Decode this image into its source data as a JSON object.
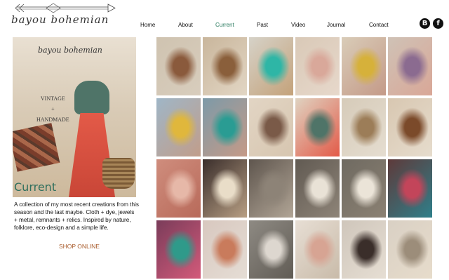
{
  "header": {
    "logo_text": "bayou bohemian",
    "logo_icon": "arrow-logo-icon"
  },
  "nav": {
    "items": [
      {
        "label": "Home",
        "active": false
      },
      {
        "label": "About",
        "active": false
      },
      {
        "label": "Current",
        "active": true
      },
      {
        "label": "Past",
        "active": false
      },
      {
        "label": "Video",
        "active": false
      },
      {
        "label": "Journal",
        "active": false
      },
      {
        "label": "Contact",
        "active": false
      }
    ],
    "active_color": "#2e7d62"
  },
  "social": {
    "blogger_glyph": "B",
    "facebook_glyph": "f",
    "icons": [
      "blogger-icon",
      "facebook-icon"
    ]
  },
  "hero": {
    "logo_text": "bayou bohemian",
    "vintage": "VINTAGE",
    "plus": "+",
    "handmade": "HANDMADE",
    "section_label": "Current"
  },
  "description": "A collection of my most recent creations from this season and the last maybe.  Cloth + dye, jewels + metal, remnants + relics. Inspired by nature, folklore, eco-design and a simple life.",
  "shop_link": "SHOP ONLINE",
  "gallery": {
    "tiles": [
      {
        "colors": [
          "#cfc3b0",
          "#8a5a3c",
          "#d8cdbd"
        ]
      },
      {
        "colors": [
          "#c9b69c",
          "#8a5f3b",
          "#e2d6c4"
        ]
      },
      {
        "colors": [
          "#d6d2c8",
          "#2eb6a6",
          "#c4a27a"
        ]
      },
      {
        "colors": [
          "#d9c9b7",
          "#d9a89a",
          "#e7d8cb"
        ]
      },
      {
        "colors": [
          "#d9ccb8",
          "#d6b13a",
          "#c49a88"
        ]
      },
      {
        "colors": [
          "#cfc2b6",
          "#8b6b90",
          "#d9a797"
        ]
      },
      {
        "colors": [
          "#9fb6c7",
          "#e0b73c",
          "#c19d8a"
        ]
      },
      {
        "colors": [
          "#7d9aa8",
          "#2a9c93",
          "#c59a87"
        ]
      },
      {
        "colors": [
          "#e2d5c4",
          "#7a5a48",
          "#d7c6b0"
        ]
      },
      {
        "colors": [
          "#dfd3c1",
          "#4f7468",
          "#e35a48"
        ]
      },
      {
        "colors": [
          "#d6cbb9",
          "#9c7d58",
          "#e5ddd0"
        ]
      },
      {
        "colors": [
          "#d8c7b1",
          "#7b4a2a",
          "#e6dccd"
        ]
      },
      {
        "colors": [
          "#cf8d7d",
          "#e6b8a8",
          "#b86a5a"
        ]
      },
      {
        "colors": [
          "#3a2e2b",
          "#e9ddc8",
          "#b89f84"
        ]
      },
      {
        "colors": [
          "#5f564e",
          "#8d8377",
          "#b1a596"
        ]
      },
      {
        "colors": [
          "#615a52",
          "#e9e2d6",
          "#8e8478"
        ]
      },
      {
        "colors": [
          "#6f6a61",
          "#ebe4d8",
          "#8b8173"
        ]
      },
      {
        "colors": [
          "#5e3a3a",
          "#c3455a",
          "#2f7f8a"
        ]
      },
      {
        "colors": [
          "#7a3c5a",
          "#2f9a8a",
          "#d35a7a"
        ]
      },
      {
        "colors": [
          "#d8c8bf",
          "#c97b5c",
          "#e5ddd5"
        ]
      },
      {
        "colors": [
          "#8e8a83",
          "#ddd7cf",
          "#615c55"
        ]
      },
      {
        "colors": [
          "#e7ded4",
          "#d7a493",
          "#c9bba9"
        ]
      },
      {
        "colors": [
          "#cfc6bb",
          "#3a2e2a",
          "#e6ded3"
        ]
      },
      {
        "colors": [
          "#d9d0c4",
          "#9c8d7a",
          "#e7dccb"
        ]
      }
    ]
  }
}
